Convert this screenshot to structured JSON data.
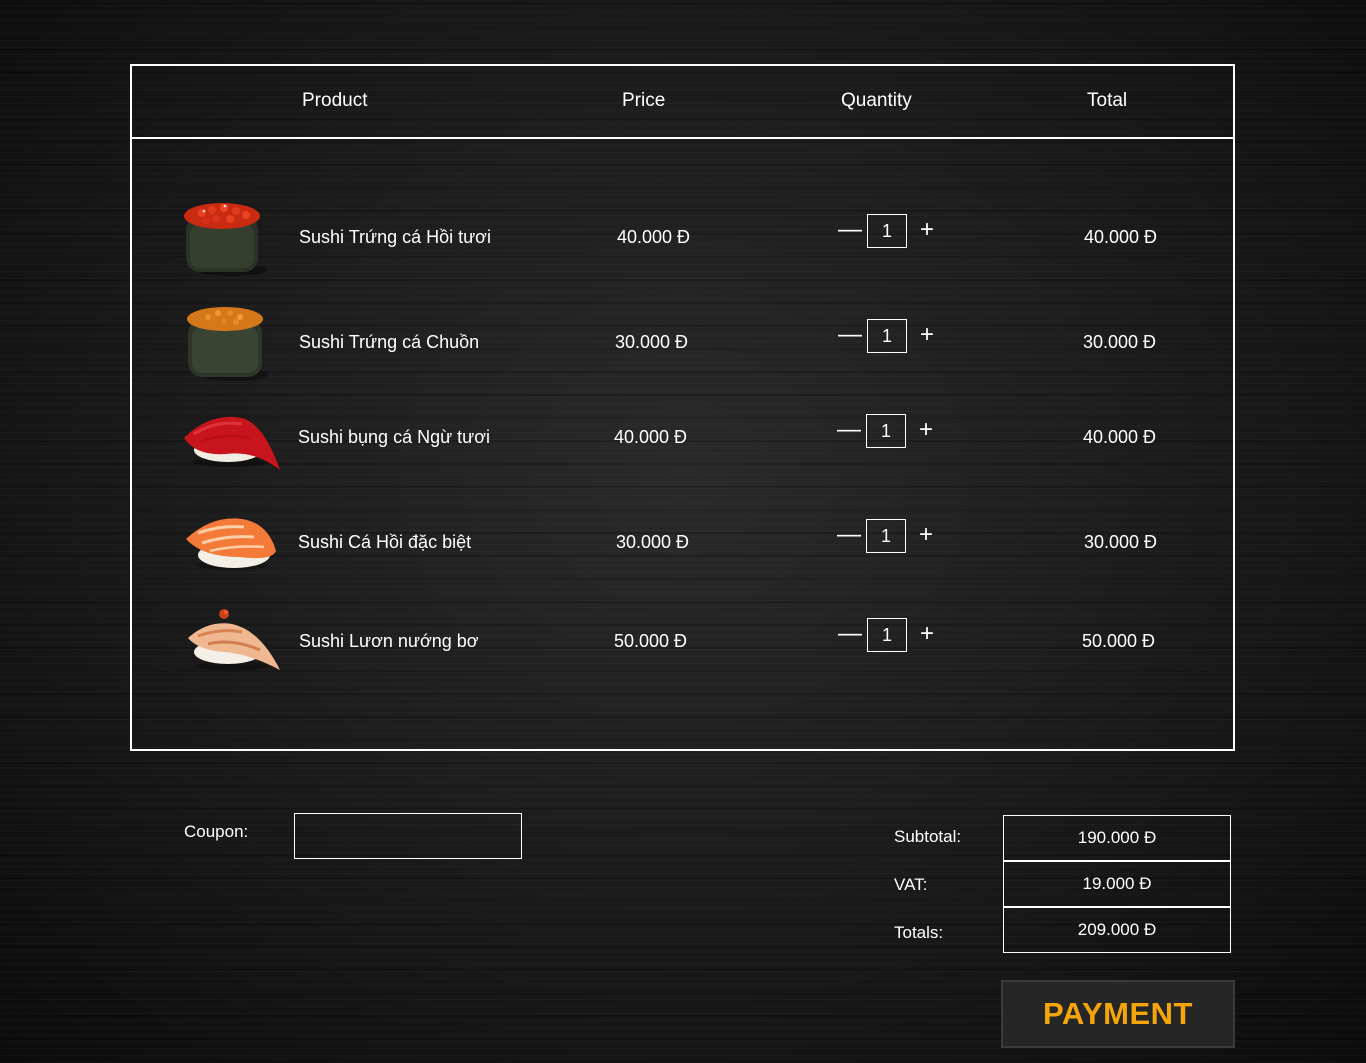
{
  "cart": {
    "headers": {
      "product": "Product",
      "price": "Price",
      "quantity": "Quantity",
      "total": "Total"
    },
    "items": [
      {
        "name": "Sushi Trứng cá Hồi tươi",
        "price": "40.000 Đ",
        "quantity": "1",
        "total": "40.000 Đ",
        "image": "salmon-roe-gunkan"
      },
      {
        "name": "Sushi Trứng cá Chuồn",
        "price": "30.000 Đ",
        "quantity": "1",
        "total": "30.000 Đ",
        "image": "flying-fish-roe-gunkan"
      },
      {
        "name": "Sushi  bụng cá Ngừ tươi",
        "price": "40.000 Đ",
        "quantity": "1",
        "total": "40.000 Đ",
        "image": "tuna-belly-nigiri"
      },
      {
        "name": "Sushi Cá Hồi đặc biệt",
        "price": "30.000 Đ",
        "quantity": "1",
        "total": "30.000 Đ",
        "image": "salmon-nigiri"
      },
      {
        "name": "Sushi Lươn nướng bơ",
        "price": "50.000 Đ",
        "quantity": "1",
        "total": "50.000 Đ",
        "image": "grilled-eel-nigiri"
      }
    ],
    "minus_symbol": "—",
    "plus_symbol": "+"
  },
  "coupon": {
    "label": "Coupon:",
    "value": ""
  },
  "summary": {
    "subtotal_label": "Subtotal:",
    "subtotal_value": "190.000 Đ",
    "vat_label": "VAT:",
    "vat_value": "19.000 Đ",
    "totals_label": "Totals:",
    "totals_value": "209.000 Đ"
  },
  "payment_label": "PAYMENT",
  "colors": {
    "background": "#141414",
    "border": "#ffffff",
    "accent": "#f5a50c"
  }
}
